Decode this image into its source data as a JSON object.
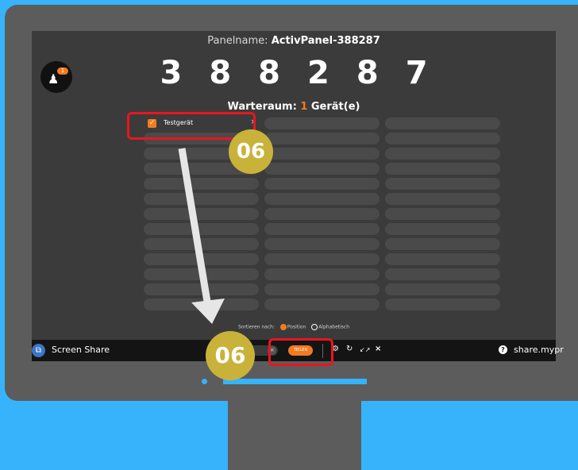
{
  "panel": {
    "label": "Panelname: ",
    "name": "ActivPanel-388287",
    "code_digits": [
      "3",
      "8",
      "8",
      "2",
      "8",
      "7"
    ]
  },
  "avatar": {
    "badge": "1",
    "icon": "person-icon"
  },
  "waiting_room": {
    "label": "Warteraum: ",
    "count": "1",
    "unit": " Gerät(e)"
  },
  "device": {
    "label": "Testgerät",
    "checked": true,
    "remove": "×"
  },
  "sort": {
    "label": "Sortieren nach:",
    "options": [
      "Position",
      "Alphabetisch"
    ],
    "selected": "Position"
  },
  "taskbar": {
    "app_label": "Screen Share",
    "teilen": "TEILEN",
    "close": "×",
    "url": "share.mypr"
  },
  "callouts": {
    "step": "06"
  },
  "colors": {
    "accent": "#f47a1f",
    "highlight": "#e8161e",
    "callout": "#c9b23a",
    "background": "#36b3fb"
  }
}
